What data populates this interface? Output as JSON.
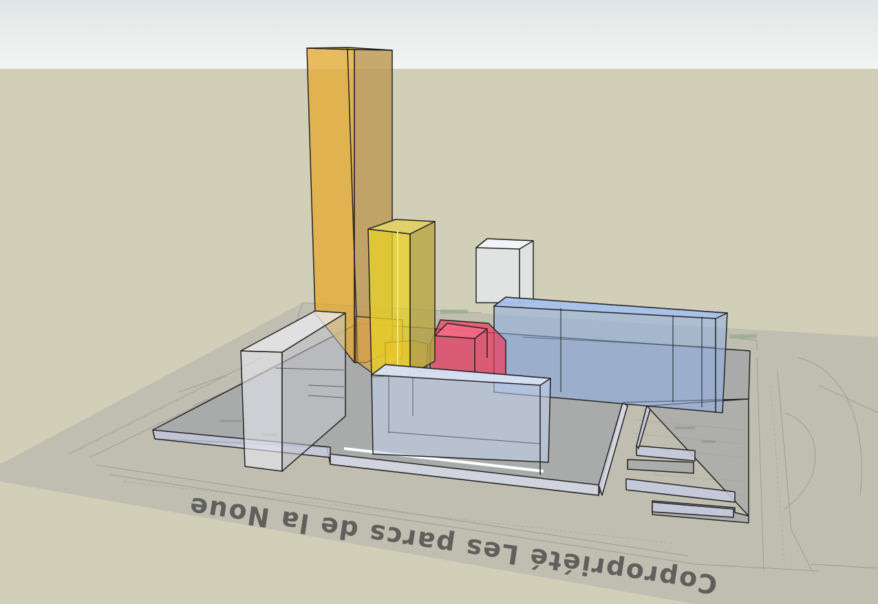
{
  "viewport": {
    "sky_color": "#eef1ef",
    "ground_color": "#d1cfb8",
    "plan_color": "#bdbcae"
  },
  "plan": {
    "label_text": "Copropriété Les parcs de la Noue",
    "label_color": "#5f5f5b"
  },
  "massing": {
    "colors": {
      "orange_tower": "#e4a82e",
      "yellow_tower": "#e8d226",
      "red_block": "#ee3b5d",
      "blue_block": "#8fb0e6",
      "white_block": "#e6e8f0",
      "gray_slab": "#c5c9da"
    }
  }
}
